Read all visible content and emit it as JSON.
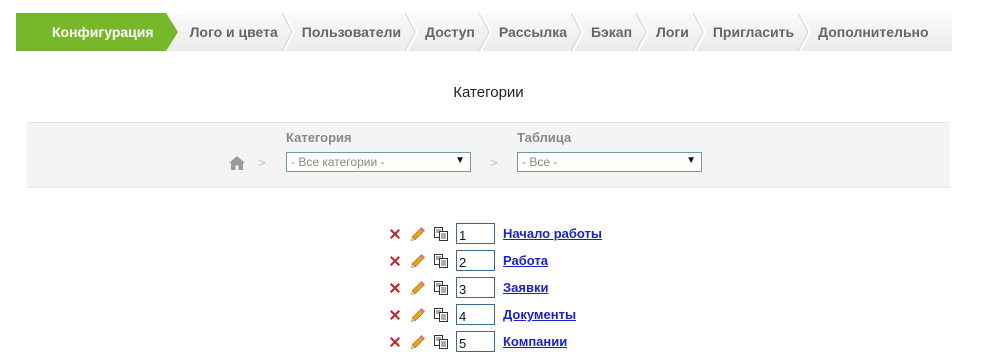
{
  "tabs": [
    {
      "label": "Конфигурация",
      "active": true
    },
    {
      "label": "Лого и цвета",
      "active": false
    },
    {
      "label": "Пользователи",
      "active": false
    },
    {
      "label": "Доступ",
      "active": false
    },
    {
      "label": "Рассылка",
      "active": false
    },
    {
      "label": "Бэкап",
      "active": false
    },
    {
      "label": "Логи",
      "active": false
    },
    {
      "label": "Пригласить",
      "active": false
    },
    {
      "label": "Дополнительно",
      "active": false
    }
  ],
  "colors": {
    "active_tab": "#76b82a",
    "link": "#1a22c8",
    "delete_icon": "#c0262c",
    "edit_icon": "#e8a317"
  },
  "page": {
    "title": "Категории"
  },
  "filters": {
    "breadcrumb_separator": ">",
    "category_label": "Категория",
    "category_value": "- Все категории -",
    "table_label": "Таблица",
    "table_value": "- Все -"
  },
  "categories": [
    {
      "order": "1",
      "name": "Начало работы"
    },
    {
      "order": "2",
      "name": "Работа"
    },
    {
      "order": "3",
      "name": "Заявки"
    },
    {
      "order": "4",
      "name": "Документы"
    },
    {
      "order": "5",
      "name": "Компании"
    }
  ],
  "icons": {
    "delete": "delete-icon",
    "edit": "pencil-icon",
    "copy": "copy-icon",
    "home": "home-icon"
  }
}
